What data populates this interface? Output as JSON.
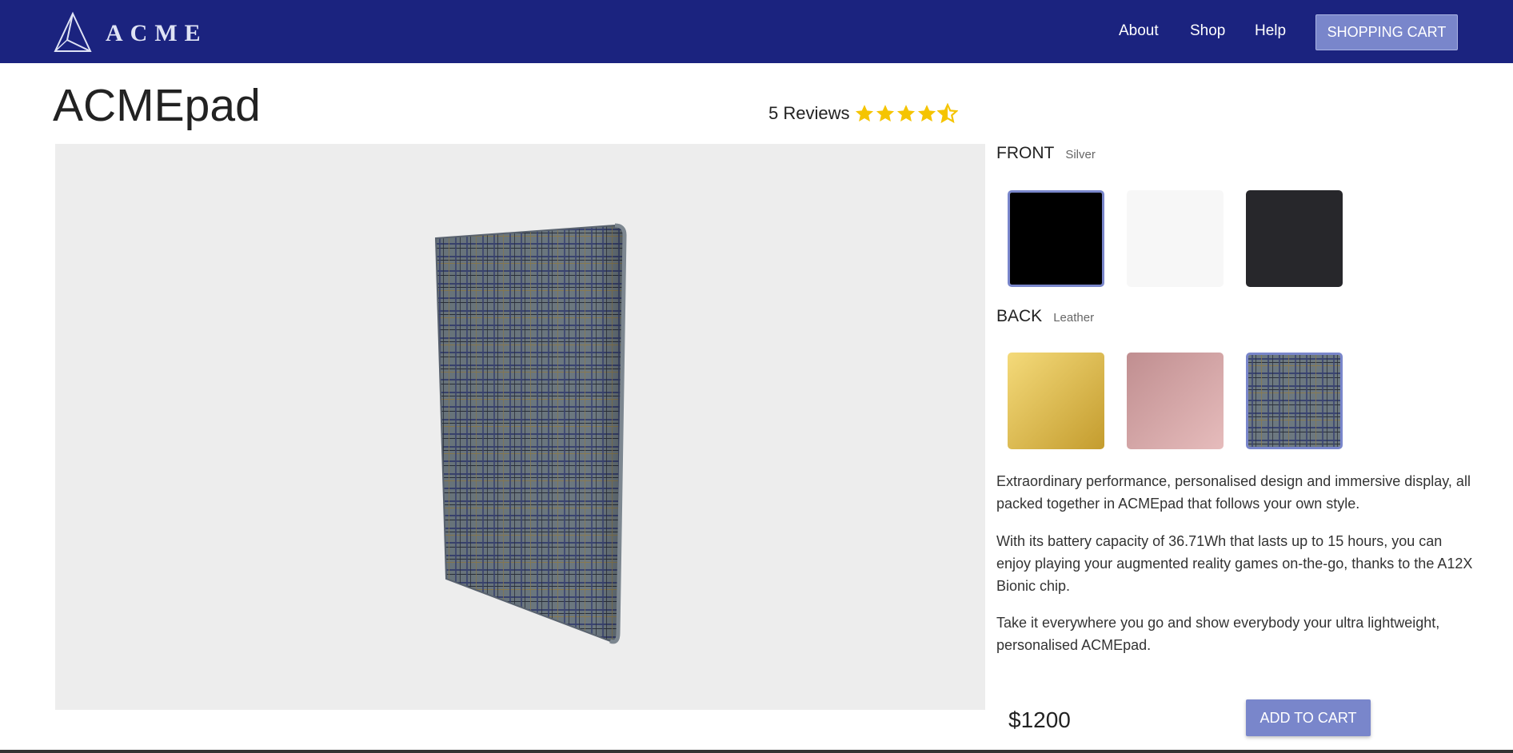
{
  "header": {
    "logo_text": "ACME",
    "nav": [
      "About",
      "Shop",
      "Help"
    ],
    "cart_label": "SHOPPING CART"
  },
  "product": {
    "title": "ACMEpad",
    "reviews_label": "5 Reviews",
    "rating": 4.5,
    "rating_max": 5
  },
  "options": {
    "front": {
      "label": "FRONT",
      "selected_name": "Silver",
      "swatches": [
        {
          "color": "#000000",
          "selected": true
        },
        {
          "color": "#f7f7f7",
          "selected": false
        },
        {
          "color": "#27272b",
          "selected": false
        }
      ]
    },
    "back": {
      "label": "BACK",
      "selected_name": "Leather",
      "swatches": [
        {
          "color": "#e2c257",
          "selected": false
        },
        {
          "color": "#d4a7a7",
          "selected": false
        },
        {
          "color": "#66707a",
          "pattern": "plaid",
          "selected": true
        }
      ]
    }
  },
  "description": [
    "Extraordinary performance, personalised design and immersive display, all packed together in ACMEpad that follows your own style.",
    "With its battery capacity of 36.71Wh that lasts up to 15 hours, you can enjoy playing your augmented reality games on-the-go, thanks to the A12X Bionic chip.",
    "Take it everywhere you go and show everybody your ultra lightweight, personalised ACMEpad."
  ],
  "purchase": {
    "price": "$1200",
    "add_label": "ADD TO CART"
  },
  "colors": {
    "header_bg": "#1b237f",
    "accent": "#7986cb",
    "star": "#f5c400",
    "viewer_bg": "#ededed"
  },
  "icons": {
    "logo": "acme-triangle-logo",
    "star": "star-icon",
    "half_star": "star-half-icon"
  }
}
